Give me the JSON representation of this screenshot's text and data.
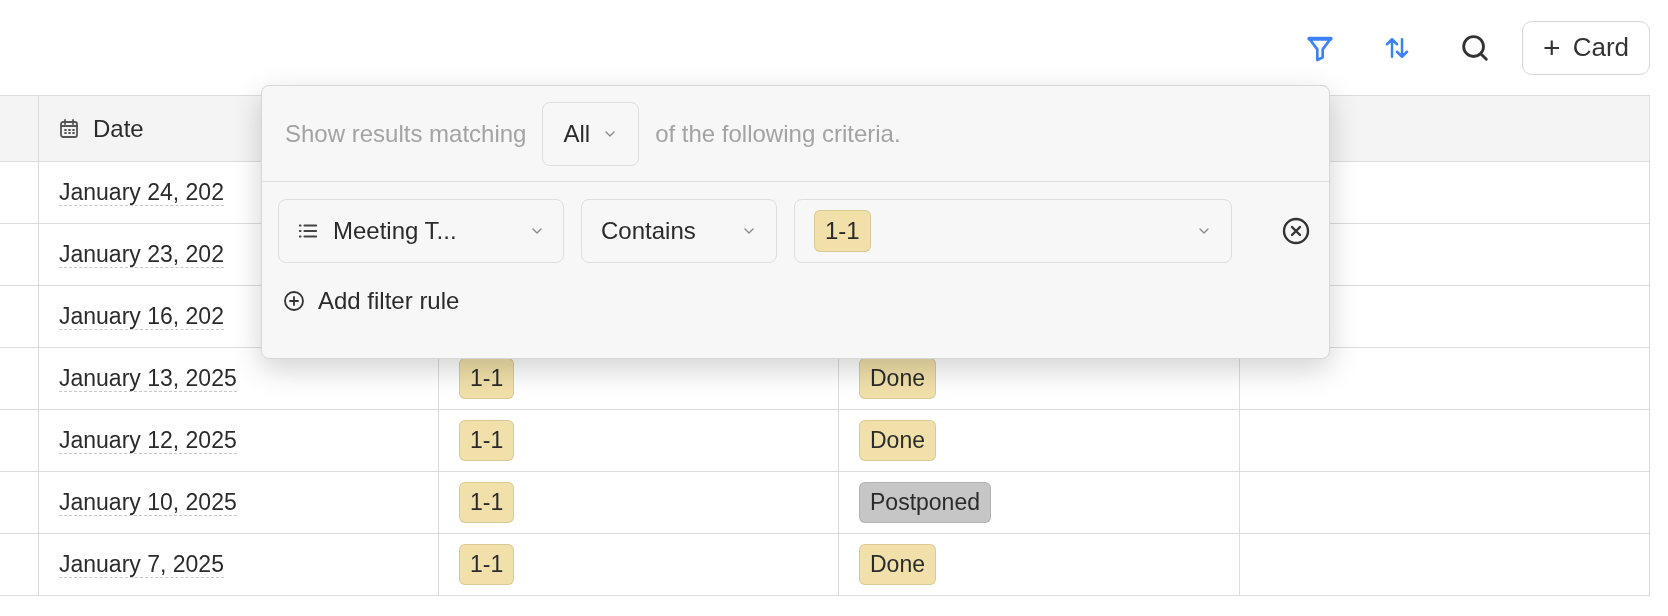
{
  "toolbar": {
    "filter_active": true,
    "sort_active": true,
    "add_button": {
      "icon": "+",
      "label": "Card"
    }
  },
  "table": {
    "columns": [
      {
        "label": "Date"
      }
    ],
    "rows": [
      {
        "date": "January 24, 202"
      },
      {
        "date": "January 23, 202"
      },
      {
        "date": "January 16, 202"
      },
      {
        "date": "January 13, 2025",
        "type": {
          "label": "1-1",
          "color": "#f1e0a9"
        },
        "status": {
          "label": "Done",
          "color": "#f1e0a9"
        }
      },
      {
        "date": "January 12, 2025",
        "type": {
          "label": "1-1",
          "color": "#f1e0a9"
        },
        "status": {
          "label": "Done",
          "color": "#f1e0a9"
        }
      },
      {
        "date": "January 10, 2025",
        "type": {
          "label": "1-1",
          "color": "#f1e0a9"
        },
        "status": {
          "label": "Postponed",
          "color": "#c6c6c6"
        }
      },
      {
        "date": "January 7, 2025",
        "type": {
          "label": "1-1",
          "color": "#f1e0a9"
        },
        "status": {
          "label": "Done",
          "color": "#f1e0a9"
        }
      }
    ]
  },
  "filter_popup": {
    "prefix": "Show results matching",
    "match": "All",
    "suffix": "of the following criteria.",
    "rules": [
      {
        "field": "Meeting T...",
        "operator": "Contains",
        "values": [
          {
            "label": "1-1",
            "color": "#f1e0a9"
          }
        ]
      }
    ],
    "add_rule": "Add filter rule"
  }
}
